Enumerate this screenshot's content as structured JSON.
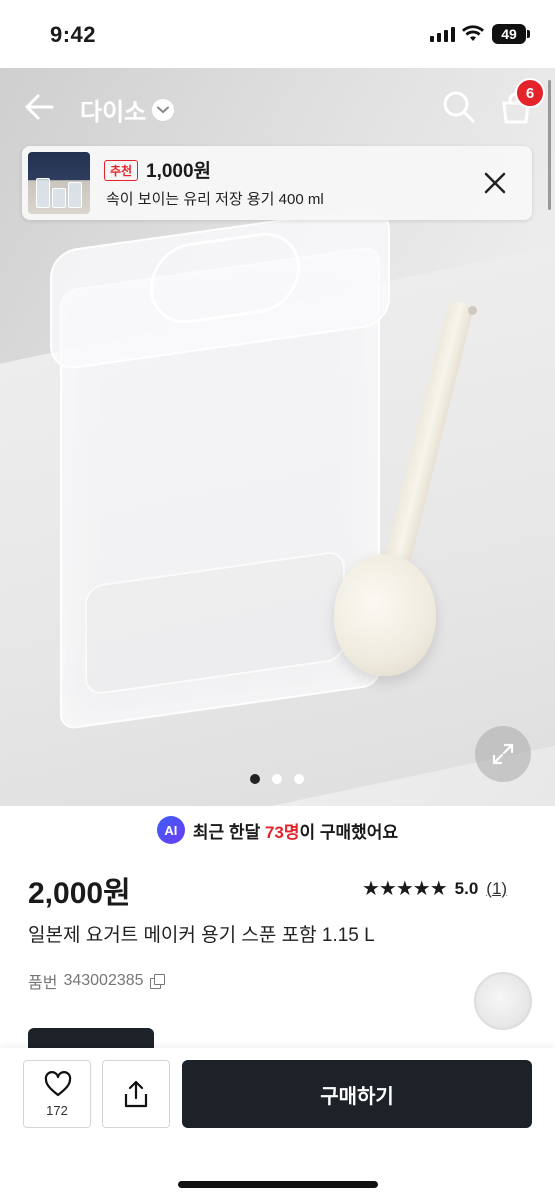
{
  "status_bar": {
    "time": "9:42",
    "battery": "49"
  },
  "nav": {
    "brand": "다이소",
    "cart_count": "6"
  },
  "recommendation": {
    "tag": "추천",
    "price": "1,000원",
    "name": "속이 보이는 유리 저장 용기 400 ml"
  },
  "carousel": {
    "current": 1,
    "total": 3
  },
  "ai_notice": {
    "badge": "AI",
    "prefix": "최근 한달 ",
    "highlight": "73명",
    "suffix": "이 구매했어요"
  },
  "product": {
    "price": "2,000원",
    "rating": {
      "stars": "★★★★★",
      "score": "5.0",
      "count": "(1)"
    },
    "name": "일본제 요거트 메이커 용기 스푼 포함 1.15 L",
    "sku_label": "품번",
    "sku": "343002385"
  },
  "bottom_bar": {
    "like_count": "172",
    "buy_label": "구매하기"
  },
  "colors": {
    "accent": "#e3242b",
    "dark": "#1d2228",
    "ai": "#4a4cf0"
  }
}
